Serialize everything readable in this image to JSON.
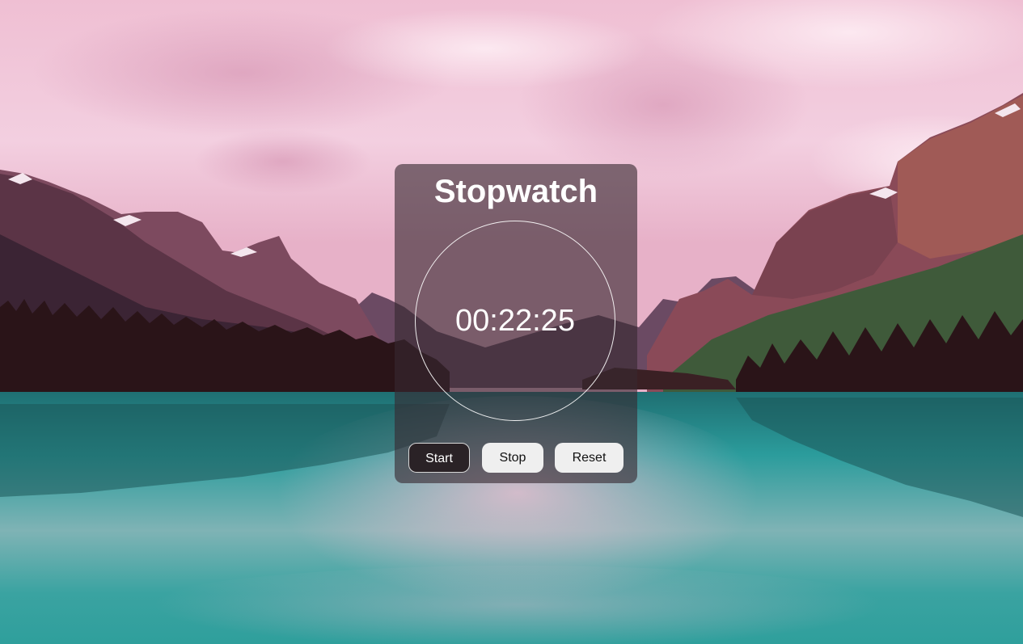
{
  "background": {
    "description_colors": {
      "sky": "#efc3d6",
      "mountain": "#7a4a5f",
      "forest": "#2a1418",
      "lake": "#2a9a9a"
    }
  },
  "stopwatch": {
    "title": "Stopwatch",
    "time": "00:22:25",
    "buttons": {
      "start": "Start",
      "stop": "Stop",
      "reset": "Reset"
    }
  }
}
